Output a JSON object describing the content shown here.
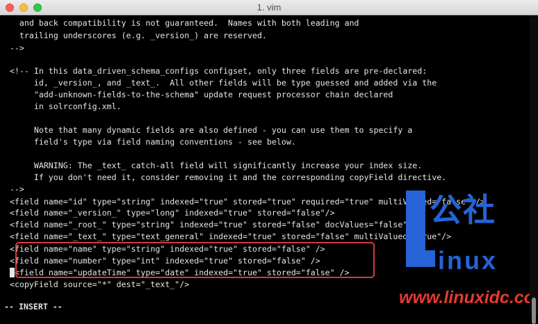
{
  "window": {
    "title": "1. vim"
  },
  "editor": {
    "lines": [
      "    and back compatibility is not guaranteed.  Names with both leading and",
      "    trailing underscores (e.g. _version_) are reserved.",
      "  -->",
      "",
      "  <!-- In this data_driven_schema_configs configset, only three fields are pre-declared:",
      "       id, _version_, and _text_.  All other fields will be type guessed and added via the",
      "       \"add-unknown-fields-to-the-schema\" update request processor chain declared",
      "       in solrconfig.xml.",
      "",
      "       Note that many dynamic fields are also defined - you can use them to specify a",
      "       field's type via field naming conventions - see below.",
      "",
      "       WARNING: The _text_ catch-all field will significantly increase your index size.",
      "       If you don't need it, consider removing it and the corresponding copyField directive.",
      "  -->",
      "  <field name=\"id\" type=\"string\" indexed=\"true\" stored=\"true\" required=\"true\" multiValued=\"false\" />",
      "  <field name=\"_version_\" type=\"long\" indexed=\"true\" stored=\"false\"/>",
      "  <field name=\"_root_\" type=\"string\" indexed=\"true\" stored=\"false\" docValues=\"false\" />",
      "  <field name=\"_text_\" type=\"text_general\" indexed=\"true\" stored=\"false\" multiValued=\"true\"/>",
      "  <field name=\"name\" type=\"string\" indexed=\"true\" stored=\"false\" />",
      "  <field name=\"number\" type=\"int\" indexed=\"true\" stored=\"false\" />"
    ],
    "cursor_line_cursor_char": " ",
    "cursor_line_rest": "<field name=\"updateTime\" type=\"date\" indexed=\"true\" stored=\"false\" />",
    "last_line": "  <copyField source=\"*\" dest=\"_text_\"/>"
  },
  "status": {
    "mode": "-- INSERT --"
  },
  "watermark": {
    "chinese": "公社",
    "inux": "inux",
    "url": "www.linuxidc.com",
    "brand_color": "#2563d6",
    "url_color": "#e23b2e"
  },
  "highlight": {
    "color": "#d93a3a"
  }
}
